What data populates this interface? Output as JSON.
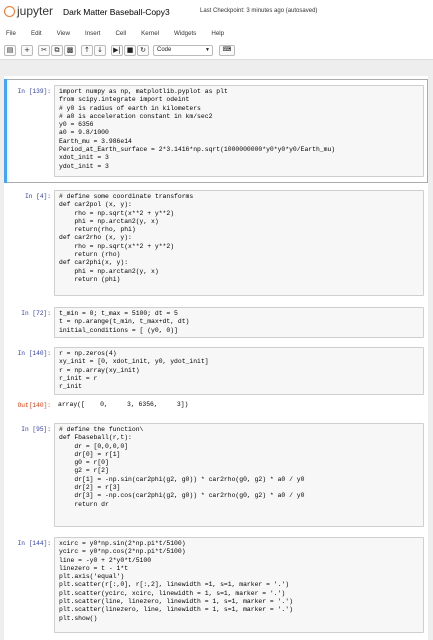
{
  "header": {
    "logo_text": "jupyter",
    "notebook_title": "Dark Matter Baseball-Copy3",
    "checkpoint": "Last Checkpoint: 3 minutes ago (autosaved)"
  },
  "menu": [
    "File",
    "Edit",
    "View",
    "Insert",
    "Cell",
    "Kernel",
    "Widgets",
    "Help"
  ],
  "toolbar": {
    "save_icon": "save-icon",
    "add_icon": "plus-icon",
    "cut_icon": "scissors-icon",
    "copy_icon": "copy-icon",
    "paste_icon": "paste-icon",
    "up_icon": "arrow-up-icon",
    "down_icon": "arrow-down-icon",
    "run_icon": "step-forward-icon",
    "stop_icon": "stop-icon",
    "restart_icon": "restart-icon",
    "cell_type": "Code",
    "keyboard_icon": "keyboard-icon"
  },
  "cells": [
    {
      "prompt": "In [139]:",
      "lines": [
        "import numpy as np, matplotlib.pyplot as plt",
        "from scipy.integrate import odeint",
        "# y0 is radius of earth in kilometers",
        "# a0 is acceleration constant in km/sec2",
        "y0 = 6356",
        "a0 = 9.8/1000",
        "Earth_mu = 3.986e14",
        "Period_at_Earth_surface = 2*3.1416*np.sqrt(1000000000*y0*y0*y0/Earth_mu)",
        "xdot_init = 3",
        "ydot_init = 3"
      ]
    },
    {
      "prompt": "In [4]:",
      "lines": [
        "# define some coordinate transforms",
        "def car2pol (x, y):",
        "    rho = np.sqrt(x**2 + y**2)",
        "    phi = np.arctan2(y, x)",
        "    return(rho, phi)",
        "def car2rho (x, y):",
        "    rho = np.sqrt(x**2 + y**2)",
        "    return (rho)",
        "def car2phi(x, y):",
        "    phi = np.arctan2(y, x)",
        "    return (phi)"
      ]
    },
    {
      "prompt": "In [72]:",
      "lines": [
        "t_min = 0; t_max = 5100; dt = 5",
        "t = np.arange(t_min, t_max+dt, dt)",
        "initial_conditions = [ (y0, 0)]"
      ]
    },
    {
      "prompt": "In [140]:",
      "lines": [
        "r = np.zeros(4)",
        "xy_init = [0, xdot_init, y0, ydot_init]",
        "r = np.array(xy_init)",
        "r_init = r",
        "r_init"
      ],
      "out_prompt": "Out[140]:",
      "output": "array([    0,     3, 6356,     3])"
    },
    {
      "prompt": "In [95]:",
      "lines": [
        "# define the function\\",
        "def Fbaseball(r,t):",
        "",
        "    dr = [0,0,0,0]",
        "    dr[0] = r[1]",
        "    g0 = r[0]",
        "    g2 = r[2]",
        "    dr[1] = -np.sin(car2phi(g2, g0)) * car2rho(g0, g2) * a0 / y0",
        "    dr[2] = r[3]",
        "    dr[3] = -np.cos(car2phi(g2, g0)) * car2rho(g0, g2) * a0 / y0",
        "    return dr"
      ]
    },
    {
      "prompt": "In [144]:",
      "lines": [
        "xcirc = y0*np.sin(2*np.pi*t/5100)",
        "ycirc = y0*np.cos(2*np.pi*t/5100)",
        "line = -y0 + 2*y0*t/5100",
        "linezero = t - 1*t",
        "plt.axis('equal')",
        "plt.scatter(r[:,0], r[:,2], linewidth =1, s=1, marker = '.')",
        "plt.scatter(ycirc, xcirc, linewidth = 1, s=1, marker = '.')",
        "plt.scatter(line, linezero, linewidth = 1, s=1, marker = '.')",
        "plt.scatter(linezero, line, linewidth = 1, s=1, marker = '.')",
        "plt.show()"
      ]
    }
  ]
}
